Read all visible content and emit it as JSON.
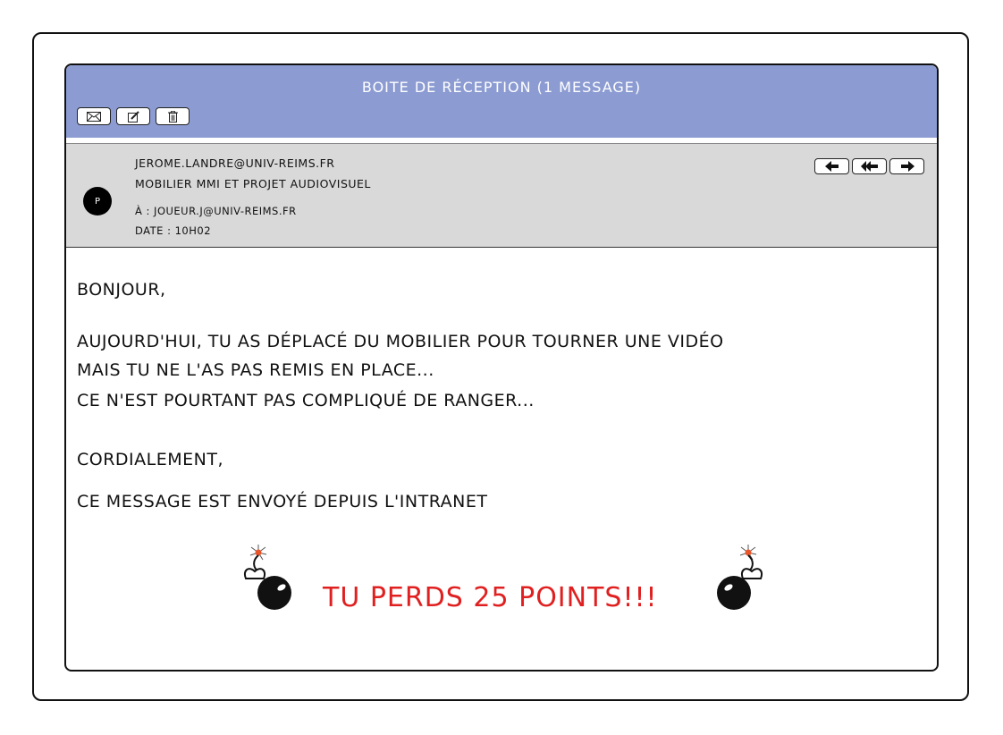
{
  "window": {
    "title": "Boite de réception  (1 message)"
  },
  "toolbar": {
    "buttons": [
      {
        "name": "mail-icon"
      },
      {
        "name": "compose-icon"
      },
      {
        "name": "trash-icon"
      }
    ]
  },
  "message": {
    "avatar_initial": "P",
    "from": "jerome.landre@univ-reims.fr",
    "subject": "Mobilier MMI et projet audiovisuel",
    "to": "À : joueur.j@univ-reims.fr",
    "date": "Date : 10h02",
    "actions": [
      {
        "name": "reply-icon"
      },
      {
        "name": "reply-all-icon"
      },
      {
        "name": "forward-icon"
      }
    ]
  },
  "body": {
    "greeting": "Bonjour,",
    "line1": "Aujourd'hui, tu as déplacé du mobilier pour tourner une vidéo",
    "line2": "mais tu ne l'as pas remis en place...",
    "line3": "Ce n'est pourtant pas compliqué de ranger...",
    "closing": "Cordialement,",
    "footer": "Ce message est envoyé depuis l'intranet"
  },
  "penalty": {
    "text": "Tu perds 25 points!!!",
    "color": "#e02020",
    "icon": "bomb-icon"
  },
  "colors": {
    "titlebar": "#8c9cd2",
    "header_bg": "#d9d9d9"
  }
}
